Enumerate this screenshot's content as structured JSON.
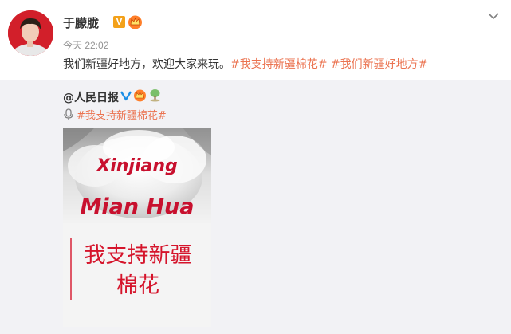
{
  "author": {
    "name": "于朦胧",
    "vip_label": "V"
  },
  "post": {
    "timestamp": "今天 22:02",
    "text": "我们新疆好地方，欢迎大家来玩。",
    "hashtags": [
      "#我支持新疆棉花#",
      "#我们新疆好地方#"
    ]
  },
  "repost": {
    "user": "@人民日报",
    "hashtag": "#我支持新疆棉花#",
    "poster": {
      "line1": "Xinjiang",
      "line2": "Mian Hua",
      "slogan": "我支持新疆棉花"
    }
  },
  "icons": {
    "vip": "vip-badge-icon",
    "crown": "crown-icon",
    "verified": "verified-icon",
    "tree": "tree-icon",
    "mic": "microphone-icon",
    "more": "chevron-down-icon"
  },
  "colors": {
    "hashtag": "#eb7350",
    "repost_bg": "#f2f2f5",
    "poster_red": "#c8102e",
    "vip_orange": "#f3a11a",
    "verified_blue": "#1a8ee6"
  }
}
